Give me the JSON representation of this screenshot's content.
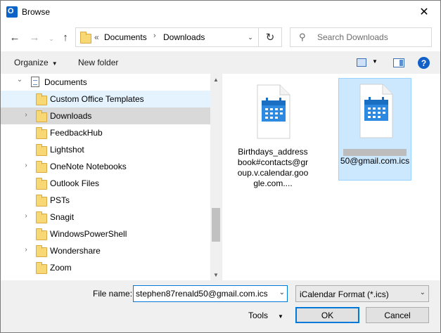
{
  "window": {
    "title": "Browse",
    "close_glyph": "✕"
  },
  "nav": {
    "back_glyph": "←",
    "forward_glyph": "→",
    "up_glyph": "↑",
    "crumb_prefix": "«",
    "crumbs": [
      "Documents",
      "Downloads"
    ],
    "chevron": "›",
    "refresh_glyph": "↻",
    "search_placeholder": "Search Downloads",
    "search_glyph": "⚲"
  },
  "toolbar": {
    "organize_label": "Organize",
    "new_folder_label": "New folder",
    "help_glyph": "?"
  },
  "tree": {
    "items": [
      {
        "label": "Documents",
        "icon": "document-icon",
        "expanded": true
      },
      {
        "label": "Custom Office Templates",
        "icon": "folder-icon"
      },
      {
        "label": "Downloads",
        "icon": "folder-icon",
        "expandable": true,
        "selected": true
      },
      {
        "label": "FeedbackHub",
        "icon": "folder-icon"
      },
      {
        "label": "Lightshot",
        "icon": "folder-icon"
      },
      {
        "label": "OneNote Notebooks",
        "icon": "folder-icon",
        "expandable": true
      },
      {
        "label": "Outlook Files",
        "icon": "folder-icon"
      },
      {
        "label": "PSTs",
        "icon": "folder-icon"
      },
      {
        "label": "Snagit",
        "icon": "folder-icon",
        "expandable": true
      },
      {
        "label": "WindowsPowerShell",
        "icon": "folder-icon"
      },
      {
        "label": "Wondershare",
        "icon": "folder-icon",
        "expandable": true
      },
      {
        "label": "Zoom",
        "icon": "folder-icon"
      }
    ],
    "expanded_glyph": "⌄",
    "collapsed_glyph": "›"
  },
  "files": [
    {
      "name": "Birthdays_addressbook#contacts@group.v.calendar.google.com....",
      "icon": "calendar-file-icon",
      "selected": false
    },
    {
      "name": "50@gmail.com.ics",
      "icon": "calendar-file-icon",
      "selected": true,
      "redacted_prefix": true
    }
  ],
  "bottom": {
    "file_name_label": "File name:",
    "file_name_value": "stephen87renald50@gmail.com.ics",
    "filter_value": "iCalendar Format (*.ics)",
    "tools_label": "Tools",
    "ok_label": "OK",
    "cancel_label": "Cancel"
  },
  "colors": {
    "accent": "#0078d7",
    "selection": "#cce8ff",
    "calendar_blue": "#2d8ae0"
  }
}
